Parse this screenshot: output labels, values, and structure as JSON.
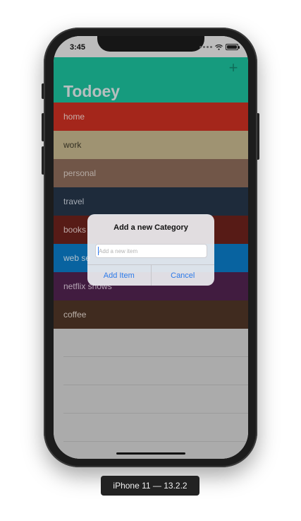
{
  "status": {
    "time": "3:45"
  },
  "navbar": {
    "title": "Todoey",
    "add_icon": "+"
  },
  "categories": [
    {
      "name": "home",
      "color": "#c92f21",
      "text_color": "#f3d3cc"
    },
    {
      "name": "work",
      "color": "#c2b48b",
      "text_color": "#3f3a2a"
    },
    {
      "name": "personal",
      "color": "#8a6a58",
      "text_color": "#dccfc7"
    },
    {
      "name": "travel",
      "color": "#253549",
      "text_color": "#c7cfd9"
    },
    {
      "name": "books",
      "color": "#6b211b",
      "text_color": "#e4cbc8"
    },
    {
      "name": "web se",
      "color": "#0a79c4",
      "text_color": "#d7ebf9"
    },
    {
      "name": "netflix shows",
      "color": "#50234f",
      "text_color": "#dcc8db"
    },
    {
      "name": "coffee",
      "color": "#4f3526",
      "text_color": "#e0d3cb"
    }
  ],
  "alert": {
    "title": "Add a new Category",
    "placeholder": "Add a new item",
    "confirm_label": "Add Item",
    "cancel_label": "Cancel"
  },
  "device_label": "iPhone 11 — 13.2.2",
  "colors": {
    "navbar": "#1cbd9a",
    "accent": "#2a7bea"
  }
}
